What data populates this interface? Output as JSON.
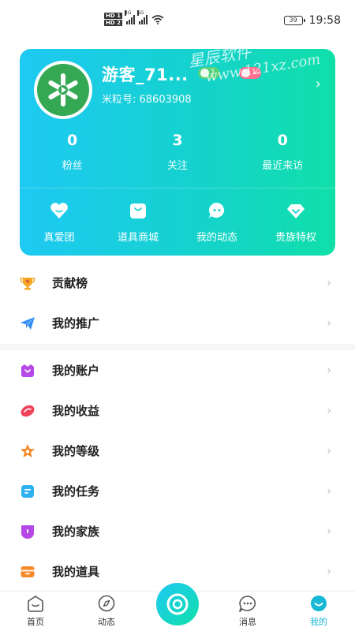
{
  "status_bar": {
    "sim1": "HD 1",
    "sim2": "HD 2",
    "net1": "4G",
    "net2": "5G",
    "battery": "39",
    "time": "19:58"
  },
  "profile": {
    "nickname": "游客_71...",
    "id_text": "米粒号: 68603908",
    "badge_a": "1",
    "badge_b": "1",
    "watermark_line1": "星辰软件",
    "watermark_line2": "www.121xz.com",
    "stats": [
      {
        "value": "0",
        "label": "粉丝"
      },
      {
        "value": "3",
        "label": "关注"
      },
      {
        "value": "0",
        "label": "最近来访"
      }
    ],
    "shortcuts": [
      {
        "label": "真爱团",
        "icon": "heart-icon"
      },
      {
        "label": "道具商城",
        "icon": "shopping-bag-icon"
      },
      {
        "label": "我的动态",
        "icon": "chat-bubble-icon"
      },
      {
        "label": "贵族特权",
        "icon": "diamond-icon"
      }
    ]
  },
  "menu": {
    "group1": [
      {
        "label": "贡献榜",
        "icon": "trophy-icon",
        "color": "#f5a623"
      },
      {
        "label": "我的推广",
        "icon": "paper-plane-icon",
        "color": "#2f8df5"
      }
    ],
    "group2": [
      {
        "label": "我的账户",
        "icon": "wallet-icon",
        "color": "#b548e6"
      },
      {
        "label": "我的收益",
        "icon": "earnings-icon",
        "color": "#f0435a"
      },
      {
        "label": "我的等级",
        "icon": "level-star-icon",
        "color": "#f58a2a"
      },
      {
        "label": "我的任务",
        "icon": "task-icon",
        "color": "#2fb1f0"
      },
      {
        "label": "我的家族",
        "icon": "family-shield-icon",
        "color": "#b548e6"
      },
      {
        "label": "我的道具",
        "icon": "props-box-icon",
        "color": "#f58a2a"
      }
    ]
  },
  "bottom_nav": [
    {
      "label": "首页",
      "icon": "home-icon",
      "active": false
    },
    {
      "label": "动态",
      "icon": "compass-icon",
      "active": false
    },
    {
      "label": "",
      "icon": "live-camera-icon",
      "active": false
    },
    {
      "label": "消息",
      "icon": "message-icon",
      "active": false
    },
    {
      "label": "我的",
      "icon": "profile-smile-icon",
      "active": true
    }
  ],
  "colors": {
    "accent": "#15d2ce",
    "gradient_start": "#1ec9f3",
    "gradient_end": "#10dfa9",
    "active_nav": "#16b8d6"
  }
}
